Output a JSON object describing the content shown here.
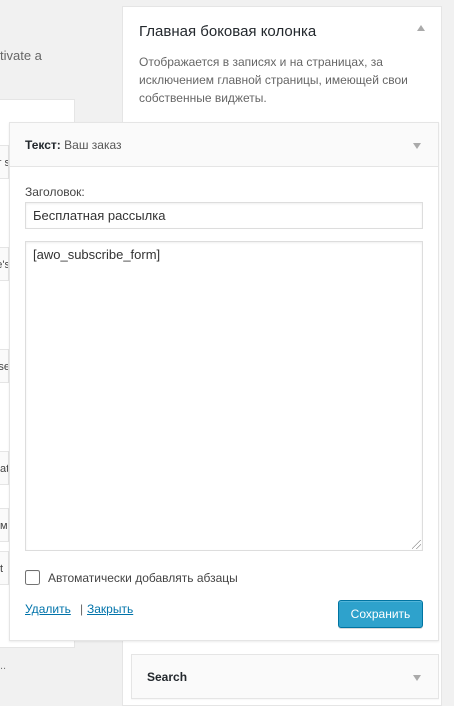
{
  "background_fragments": {
    "top_text": "tivate a",
    "row_fragments": [
      "r s",
      "e's",
      "se",
      "at",
      "м",
      "t"
    ],
    "bottom_text": ".."
  },
  "sidebar": {
    "title": "Главная боковая колонка",
    "description": "Отображается в записях и на страницах, за исключением главной страницы, имеющей свои собственные виджеты.",
    "toggle_icon": "arrow-up-icon"
  },
  "text_widget": {
    "type_label": "Текст:",
    "title_label": "Ваш заказ",
    "toggle_icon": "arrow-down-icon",
    "heading_label": "Заголовок:",
    "heading_value": "Бесплатная рассылка",
    "content_value": "[awo_subscribe_form]",
    "auto_paragraph_label": "Автоматически добавлять абзацы",
    "auto_paragraph_checked": false,
    "delete_label": "Удалить",
    "separator": "|",
    "close_label": "Закрыть",
    "save_label": "Сохранить"
  },
  "search_widget": {
    "title": "Search",
    "toggle_icon": "arrow-down-icon"
  },
  "colors": {
    "background": "#f1f1f1",
    "link": "#0073aa",
    "primary_button": "#2ea2cc"
  }
}
